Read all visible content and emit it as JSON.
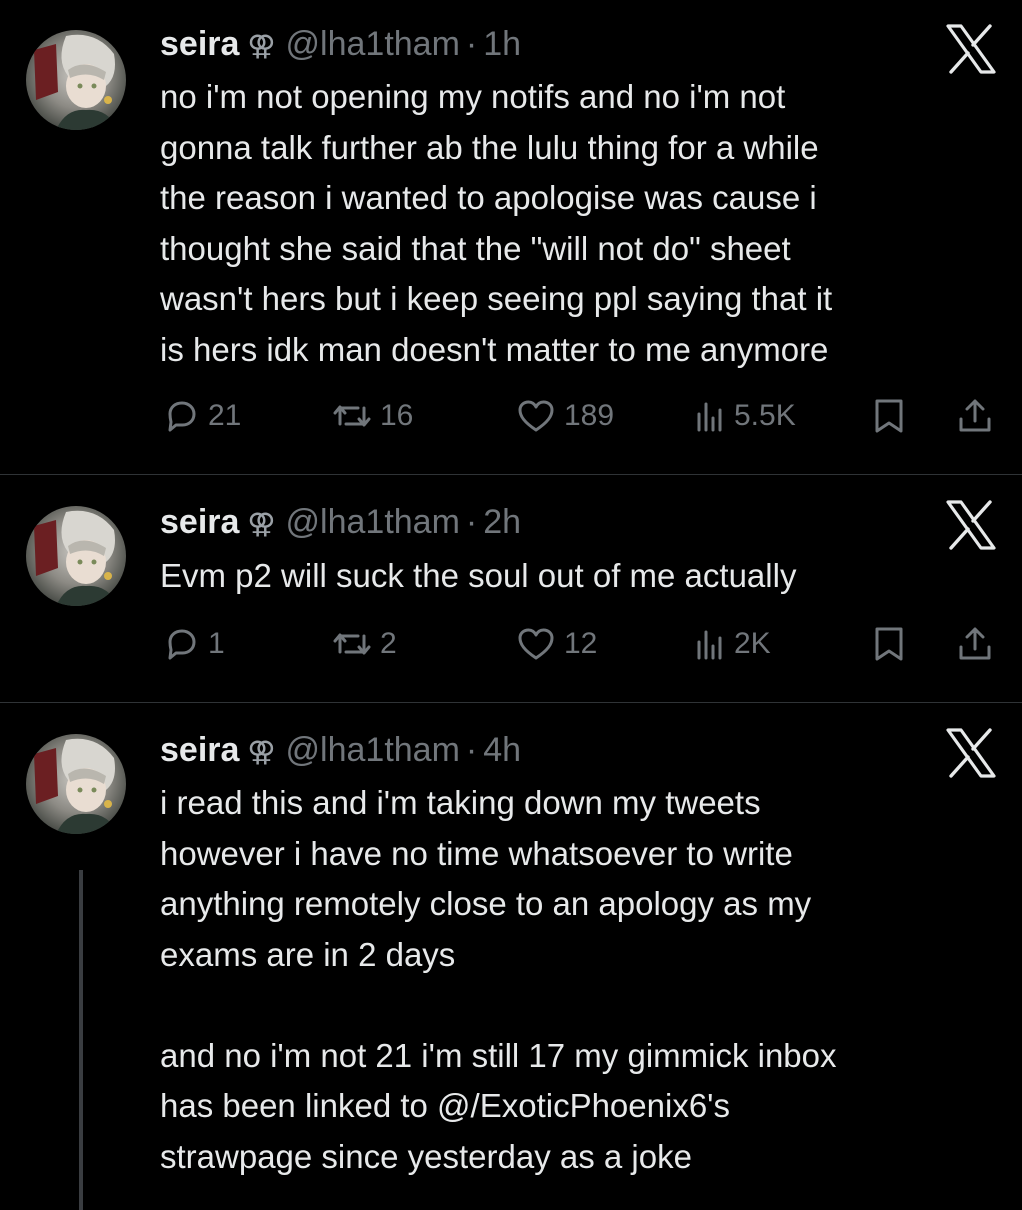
{
  "tweets": [
    {
      "name": "seira",
      "gender_symbol": "⚢",
      "handle": "@lha1tham",
      "separator": "·",
      "time": "1h",
      "text": "no i'm not opening my notifs and no i'm not\ngonna talk further ab the lulu thing for a while\nthe reason i wanted to apologise was cause i\nthought she said that the \"will not do\" sheet\nwasn't hers but i keep seeing ppl saying that it\nis hers idk man doesn't matter to me anymore",
      "replies": "21",
      "retweets": "16",
      "likes": "189",
      "views": "5.5K"
    },
    {
      "name": "seira",
      "gender_symbol": "⚢",
      "handle": "@lha1tham",
      "separator": "·",
      "time": "2h",
      "text": "Evm p2 will suck the soul out of me actually",
      "replies": "1",
      "retweets": "2",
      "likes": "12",
      "views": "2K"
    },
    {
      "name": "seira",
      "gender_symbol": "⚢",
      "handle": "@lha1tham",
      "separator": "·",
      "time": "4h",
      "text": "i read this and i'm taking down my tweets\nhowever i have no time whatsoever to write\nanything remotely close to an apology as my\nexams are in 2 days\n\nand no i'm not 21 i'm still 17 my gimmick inbox\nhas been linked to @/ExoticPhoenix6's\nstrawpage since yesterday as a joke"
    }
  ],
  "icons": {
    "reply": "reply-icon",
    "retweet": "retweet-icon",
    "like": "heart-icon",
    "views": "views-icon",
    "bookmark": "bookmark-icon",
    "share": "share-icon",
    "platform": "x-logo-icon"
  },
  "colors": {
    "background": "#000000",
    "text": "#e7e9ea",
    "muted": "#71767b",
    "divider": "#2f3336"
  }
}
